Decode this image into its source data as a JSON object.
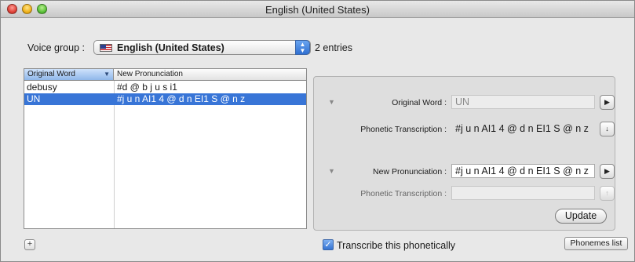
{
  "window": {
    "title": "English (United States)"
  },
  "voice_group": {
    "label": "Voice group :",
    "selected": "English (United States)",
    "entries_count": "2 entries"
  },
  "table": {
    "columns": [
      "Original Word",
      "New Pronunciation"
    ],
    "rows": [
      {
        "word": "debusy",
        "pronunciation": "#d @ b j u s i1"
      },
      {
        "word": "UN",
        "pronunciation": "#j u n AI1 4 @ d n EI1 S @ n z"
      }
    ],
    "selected_row": 1
  },
  "panel": {
    "original_word_label": "Original Word :",
    "original_word_value": "UN",
    "phonetic_label": "Phonetic Transcription :",
    "phonetic_value": "#j u n AI1 4 @ d n EI1 S @ n z",
    "new_pron_label": "New Pronunciation :",
    "new_pron_value": "#j u n AI1 4 @ d n EI1 S @ n z",
    "phonetic2_label": "Phonetic Transcription :",
    "phonetic2_value": "",
    "update_label": "Update"
  },
  "footer": {
    "transcribe_label": "Transcribe this phonetically",
    "transcribe_checked": true,
    "phonemes_label": "Phonemes list"
  },
  "icons": {
    "add": "+",
    "play": "▶",
    "down_arrow": "↓",
    "up_arrow": "↑",
    "disclosure": "▼",
    "check": "✓"
  },
  "colors": {
    "selection": "#3875d7",
    "header_accent": "#8fb7ea"
  }
}
